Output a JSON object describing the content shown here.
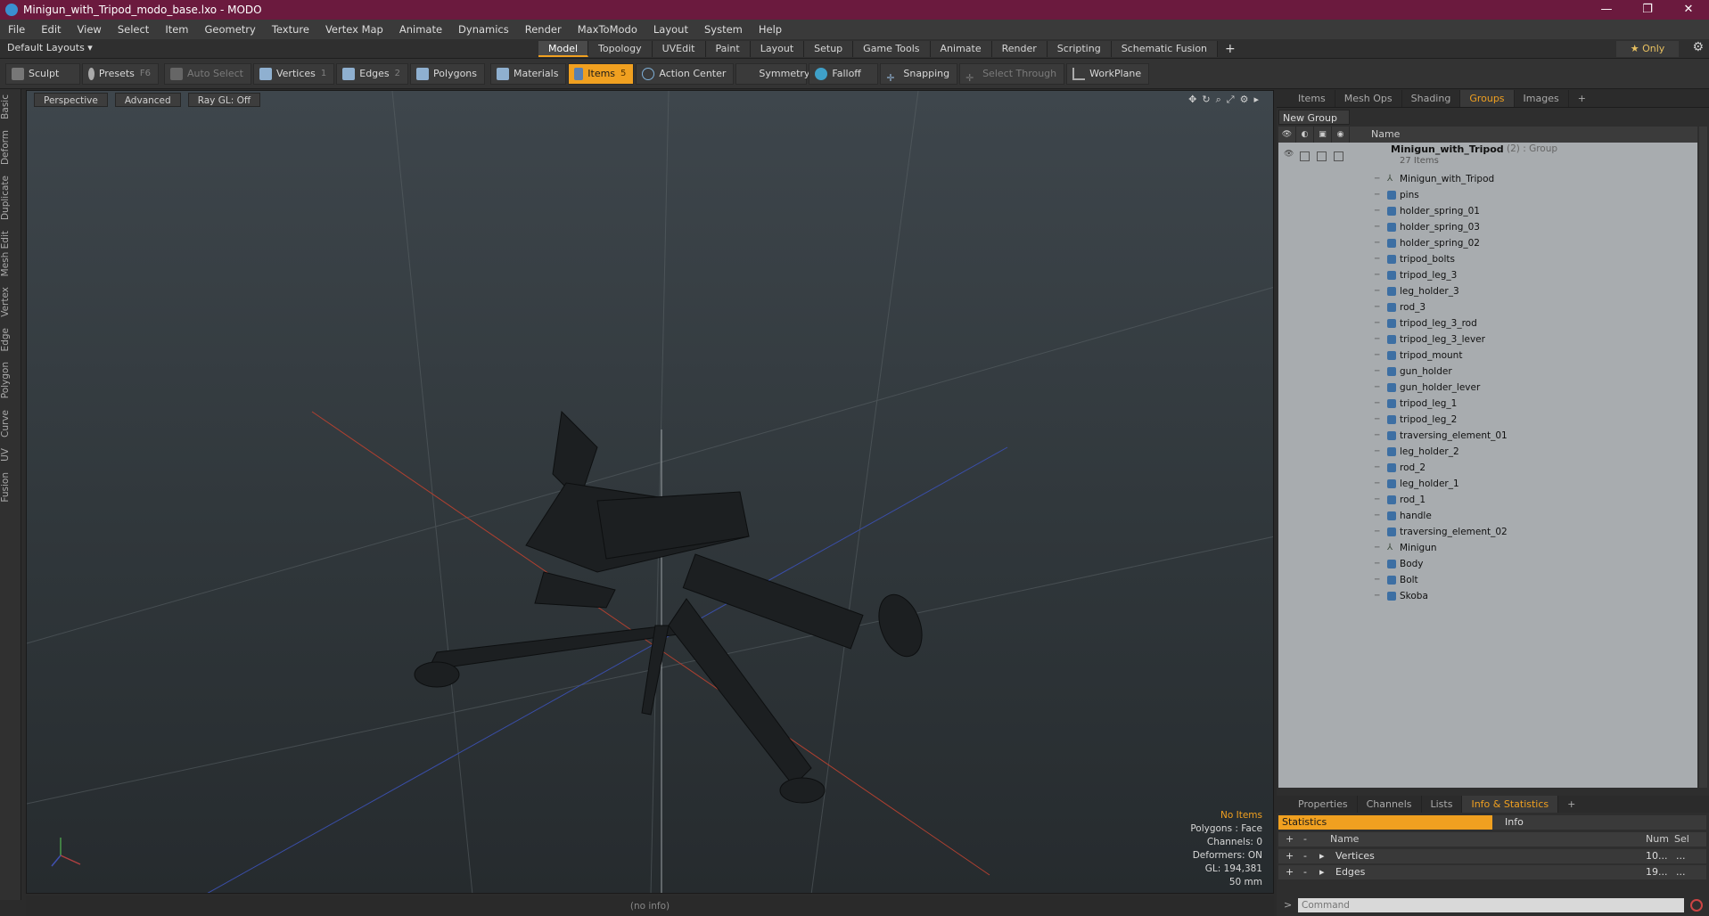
{
  "window": {
    "title": "Minigun_with_Tripod_modo_base.lxo - MODO",
    "minimize": "—",
    "maximize": "❐",
    "close": "✕"
  },
  "menu": [
    "File",
    "Edit",
    "View",
    "Select",
    "Item",
    "Geometry",
    "Texture",
    "Vertex Map",
    "Animate",
    "Dynamics",
    "Render",
    "MaxToModo",
    "Layout",
    "System",
    "Help"
  ],
  "layouts": {
    "dropdown": "Default Layouts ▾",
    "tabs": [
      "Model",
      "Topology",
      "UVEdit",
      "Paint",
      "Layout",
      "Setup",
      "Game Tools",
      "Animate",
      "Render",
      "Scripting",
      "Schematic Fusion"
    ],
    "active": "Model",
    "plus": "+",
    "only": "★ Only"
  },
  "toolbar": {
    "sculpt": "Sculpt",
    "presets": "Presets",
    "presets_key": "F6",
    "auto_select": "Auto Select",
    "vertices": "Vertices",
    "vertices_count": "1",
    "edges": "Edges",
    "edges_count": "2",
    "polygons": "Polygons",
    "materials": "Materials",
    "items": "Items",
    "items_count": "5",
    "action_center": "Action Center",
    "symmetry": "Symmetry",
    "falloff": "Falloff",
    "snapping": "Snapping",
    "select_through": "Select Through",
    "workplane": "WorkPlane"
  },
  "left_tabs": [
    "Basic",
    "Deform",
    "Duplicate",
    "Mesh Edit",
    "Vertex",
    "Edge",
    "Polygon",
    "Curve",
    "UV",
    "Fusion"
  ],
  "viewport": {
    "perspective": "Perspective",
    "advanced": "Advanced",
    "raygl": "Ray GL: Off",
    "stats": {
      "items": "No Items",
      "polygons": "Polygons : Face",
      "channels": "Channels: 0",
      "deformers": "Deformers: ON",
      "gl": "GL: 194,381",
      "focal": "50 mm"
    }
  },
  "status": "(no info)",
  "right_panel": {
    "tabs": [
      "Items",
      "Mesh Ops",
      "Shading",
      "Groups",
      "Images"
    ],
    "active_tab": "Groups",
    "plus": "+",
    "new_group": "New Group",
    "column_name": "Name",
    "root": {
      "name": "Minigun_with_Tripod",
      "count": "(2) : Group",
      "sub": "27 Items"
    },
    "items": [
      {
        "label": "Minigun_with_Tripod",
        "type": "locator"
      },
      {
        "label": "pins",
        "type": "mesh"
      },
      {
        "label": "holder_spring_01",
        "type": "mesh"
      },
      {
        "label": "holder_spring_03",
        "type": "mesh"
      },
      {
        "label": "holder_spring_02",
        "type": "mesh"
      },
      {
        "label": "tripod_bolts",
        "type": "mesh"
      },
      {
        "label": "tripod_leg_3",
        "type": "mesh"
      },
      {
        "label": "leg_holder_3",
        "type": "mesh"
      },
      {
        "label": "rod_3",
        "type": "mesh"
      },
      {
        "label": "tripod_leg_3_rod",
        "type": "mesh"
      },
      {
        "label": "tripod_leg_3_lever",
        "type": "mesh"
      },
      {
        "label": "tripod_mount",
        "type": "mesh"
      },
      {
        "label": "gun_holder",
        "type": "mesh"
      },
      {
        "label": "gun_holder_lever",
        "type": "mesh"
      },
      {
        "label": "tripod_leg_1",
        "type": "mesh"
      },
      {
        "label": "tripod_leg_2",
        "type": "mesh"
      },
      {
        "label": "traversing_element_01",
        "type": "mesh"
      },
      {
        "label": "leg_holder_2",
        "type": "mesh"
      },
      {
        "label": "rod_2",
        "type": "mesh"
      },
      {
        "label": "leg_holder_1",
        "type": "mesh"
      },
      {
        "label": "rod_1",
        "type": "mesh"
      },
      {
        "label": "handle",
        "type": "mesh"
      },
      {
        "label": "traversing_element_02",
        "type": "mesh"
      },
      {
        "label": "Minigun",
        "type": "locator"
      },
      {
        "label": "Body",
        "type": "mesh"
      },
      {
        "label": "Bolt",
        "type": "mesh"
      },
      {
        "label": "Skoba",
        "type": "mesh"
      }
    ]
  },
  "bottom_panel": {
    "tabs": [
      "Properties",
      "Channels",
      "Lists",
      "Info & Statistics"
    ],
    "active_tab": "Info & Statistics",
    "plus": "+",
    "statistics": "Statistics",
    "info": "Info",
    "col_name": "Name",
    "col_num": "Num",
    "col_sel": "Sel",
    "rows": [
      {
        "name": "Vertices",
        "num": "10...",
        "sel": "..."
      },
      {
        "name": "Edges",
        "num": "19...",
        "sel": "..."
      }
    ],
    "command_placeholder": "Command"
  },
  "colors": {
    "accent": "#f0a020",
    "titlebar": "#6b1a3e"
  }
}
